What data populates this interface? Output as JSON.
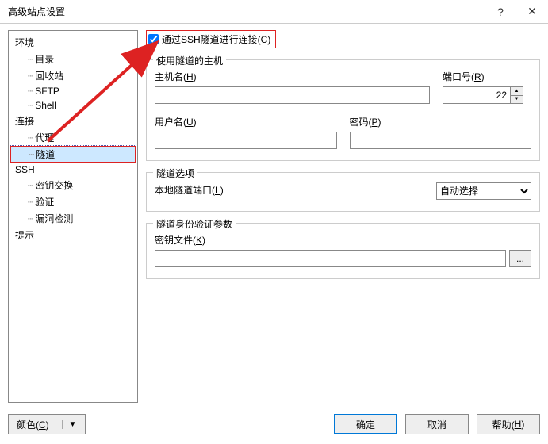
{
  "window": {
    "title": "高级站点设置"
  },
  "tree": {
    "env": "环境",
    "dir": "目录",
    "recycle": "回收站",
    "sftp": "SFTP",
    "shell": "Shell",
    "conn": "连接",
    "proxy": "代理",
    "tunnel": "隧道",
    "ssh": "SSH",
    "keyex": "密钥交换",
    "auth": "验证",
    "bugs": "漏洞检测",
    "hint": "提示"
  },
  "checkbox": {
    "label_pre": "通过SSH隧道进行连接(",
    "accel": "C",
    "label_post": ")"
  },
  "group_host": {
    "legend": "使用隧道的主机",
    "hostname_label_pre": "主机名(",
    "hostname_accel": "H",
    "hostname_label_post": ")",
    "hostname_value": "",
    "port_label_pre": "端口号(",
    "port_accel": "R",
    "port_label_post": ")",
    "port_value": "22",
    "user_label_pre": "用户名(",
    "user_accel": "U",
    "user_label_post": ")",
    "user_value": "",
    "pass_label_pre": "密码(",
    "pass_accel": "P",
    "pass_label_post": ")",
    "pass_value": ""
  },
  "group_tunnel": {
    "legend": "隧道选项",
    "localport_label_pre": "本地隧道端口(",
    "localport_accel": "L",
    "localport_label_post": ")",
    "select_value": "自动选择"
  },
  "group_auth": {
    "legend": "隧道身份验证参数",
    "keyfile_label_pre": "密钥文件(",
    "keyfile_accel": "K",
    "keyfile_label_post": ")",
    "keyfile_value": "",
    "browse": "..."
  },
  "buttons": {
    "color_pre": "颜色(",
    "color_accel": "C",
    "color_post": ")",
    "ok": "确定",
    "cancel": "取消",
    "help_pre": "帮助(",
    "help_accel": "H",
    "help_post": ")"
  }
}
